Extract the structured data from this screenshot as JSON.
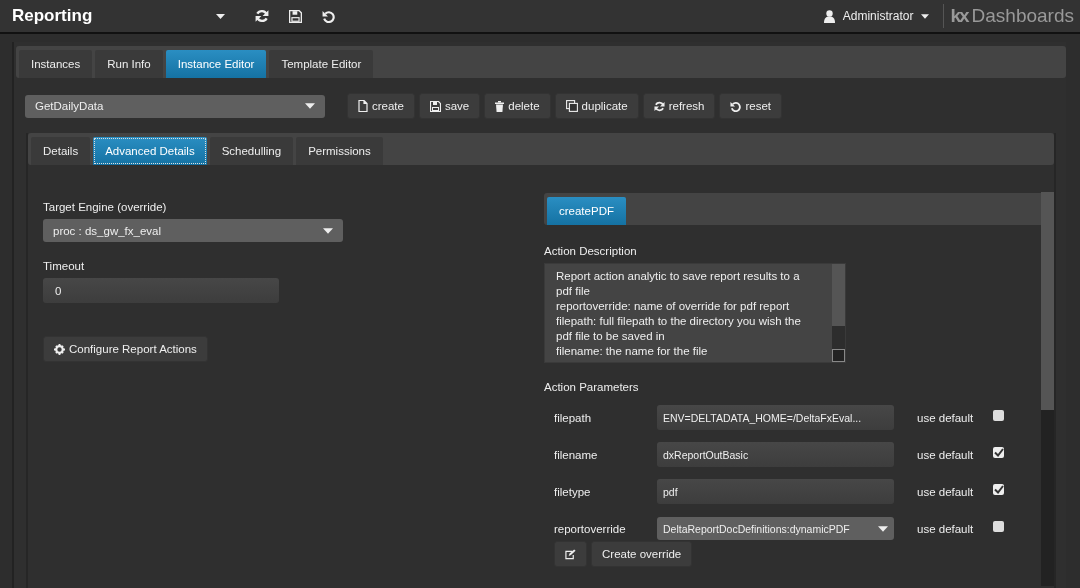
{
  "header": {
    "title": "Reporting",
    "user": "Administrator",
    "brand_mark": "kx",
    "brand": "Dashboards"
  },
  "tabs": [
    {
      "label": "Instances",
      "selected": false
    },
    {
      "label": "Run Info",
      "selected": false
    },
    {
      "label": "Instance Editor",
      "selected": true
    },
    {
      "label": "Template Editor",
      "selected": false
    }
  ],
  "instance_select": {
    "value": "GetDailyData"
  },
  "toolbar": [
    {
      "label": "create",
      "kind": "file"
    },
    {
      "label": "save",
      "kind": "save"
    },
    {
      "label": "delete",
      "kind": "trash"
    },
    {
      "label": "duplicate",
      "kind": "copy"
    },
    {
      "label": "refresh",
      "kind": "refresh"
    },
    {
      "label": "reset",
      "kind": "reset"
    }
  ],
  "subtabs": [
    {
      "label": "Details",
      "selected": false
    },
    {
      "label": "Advanced Details",
      "selected": true
    },
    {
      "label": "Schedulling",
      "selected": false
    },
    {
      "label": "Permissions",
      "selected": false
    }
  ],
  "target_engine": {
    "label": "Target Engine (override)",
    "value": "proc : ds_gw_fx_eval"
  },
  "timeout": {
    "label": "Timeout",
    "value": "0"
  },
  "configure_button": "Configure Report Actions",
  "action_tabs": [
    {
      "label": "createPDF",
      "selected": true
    }
  ],
  "action_description": {
    "label": "Action Description",
    "lines": [
      "Report action analytic to save report results to a",
      "pdf file",
      "reportoverride: name of override for pdf report",
      "filepath: full filepath to the directory you wish the",
      "pdf file to be saved in",
      "filename: the name for the file"
    ]
  },
  "action_parameters": {
    "label": "Action Parameters",
    "rows": [
      {
        "name": "filepath",
        "kind": "text",
        "value": "ENV=DELTADATA_HOME=/DeltaFxEval...",
        "default_label": "use default",
        "checked": false
      },
      {
        "name": "filename",
        "kind": "text",
        "value": "dxReportOutBasic",
        "default_label": "use default",
        "checked": true
      },
      {
        "name": "filetype",
        "kind": "text",
        "value": "pdf",
        "default_label": "use default",
        "checked": true
      },
      {
        "name": "reportoverride",
        "kind": "select",
        "value": "DeltaReportDocDefinitions:dynamicPDF",
        "default_label": "use default",
        "checked": false
      }
    ]
  },
  "create_override": "Create override"
}
